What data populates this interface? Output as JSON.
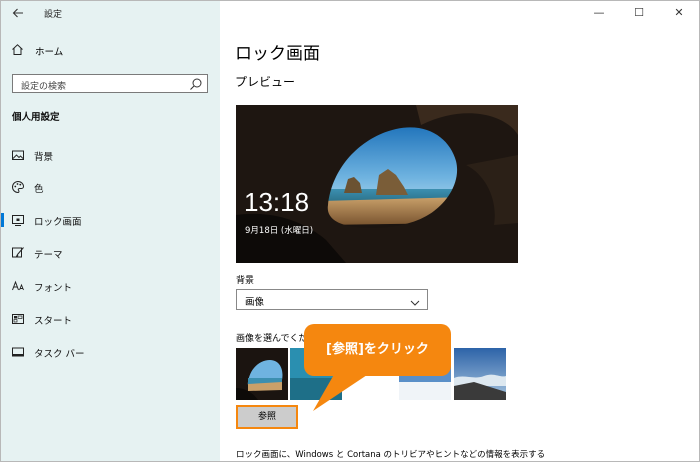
{
  "window": {
    "title": "設定",
    "back_icon": "back-arrow-icon",
    "controls": {
      "minimize": "—",
      "maximize": "☐",
      "close": "✕"
    }
  },
  "sidebar": {
    "home_label": "ホーム",
    "search_placeholder": "設定の検索",
    "section_title": "個人用設定",
    "items": [
      {
        "label": "背景",
        "icon": "image-icon"
      },
      {
        "label": "色",
        "icon": "palette-icon"
      },
      {
        "label": "ロック画面",
        "icon": "lock-screen-icon",
        "active": true
      },
      {
        "label": "テーマ",
        "icon": "theme-brush-icon"
      },
      {
        "label": "フォント",
        "icon": "font-icon"
      },
      {
        "label": "スタート",
        "icon": "start-icon"
      },
      {
        "label": "タスク バー",
        "icon": "taskbar-icon"
      }
    ]
  },
  "main": {
    "title": "ロック画面",
    "preview_label": "プレビュー",
    "clock": "13:18",
    "date": "9月18日 (水曜日)",
    "background_label": "背景",
    "background_value": "画像",
    "choose_label": "画像を選んでくだ",
    "browse_label": "参照",
    "bottom_text": "ロック画面に、Windows と Cortana のトリビアやヒントなどの情報を表示する"
  },
  "callout": {
    "text": "[参照]をクリック",
    "color": "#f5870f"
  },
  "colors": {
    "sidebar_bg": "#e6f2f2",
    "accent": "#0078d7",
    "highlight": "#f5870f"
  }
}
